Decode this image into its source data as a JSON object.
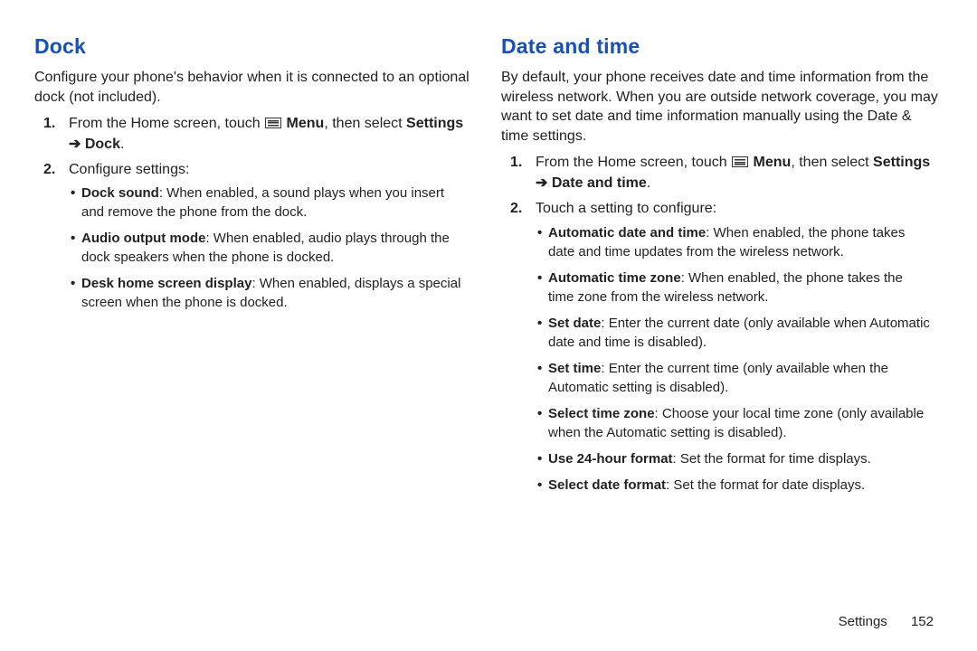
{
  "left": {
    "heading": "Dock",
    "intro": "Configure your phone's behavior when it is connected to an optional dock (not included).",
    "step1_a": "From the Home screen, touch ",
    "step1_menu": "Menu",
    "step1_b": ", then select ",
    "step1_path_a": "Settings ",
    "step1_arrow": "➔",
    "step1_path_b": " Dock",
    "step1_period": ".",
    "step2": "Configure settings:",
    "bullets": [
      {
        "label": "Dock sound",
        "text": ": When enabled, a sound plays when you insert and remove the phone from the dock."
      },
      {
        "label": "Audio output mode",
        "text": ": When enabled, audio plays through the dock speakers when the phone is docked."
      },
      {
        "label": "Desk home screen display",
        "text": ": When enabled, displays a special screen when the phone is docked."
      }
    ]
  },
  "right": {
    "heading": "Date and time",
    "intro": "By default, your phone receives date and time information from the wireless network. When you are outside network coverage, you may want to set date and time information manually using the Date & time settings.",
    "step1_a": "From the Home screen, touch ",
    "step1_menu": "Menu",
    "step1_b": ", then select ",
    "step1_path_a": "Settings ",
    "step1_arrow": "➔",
    "step1_path_b": " Date and time",
    "step1_period": ".",
    "step2": "Touch a setting to configure:",
    "bullets": [
      {
        "label": "Automatic date and time",
        "text": ": When enabled, the phone takes date and time updates from the wireless network."
      },
      {
        "label": "Automatic time zone",
        "text": ": When enabled, the phone takes the time zone from the wireless network."
      },
      {
        "label": "Set date",
        "text": ": Enter the current date (only available when Automatic date and time is disabled)."
      },
      {
        "label": "Set time",
        "text": ": Enter the current time (only available when the Automatic setting is disabled)."
      },
      {
        "label": "Select time zone",
        "text": ": Choose your local time zone (only available when the Automatic setting is disabled)."
      },
      {
        "label": "Use 24-hour format",
        "text": ": Set the format for time displays."
      },
      {
        "label": "Select date format",
        "text": ": Set the format for date displays."
      }
    ]
  },
  "footer": {
    "section": "Settings",
    "page": "152"
  }
}
